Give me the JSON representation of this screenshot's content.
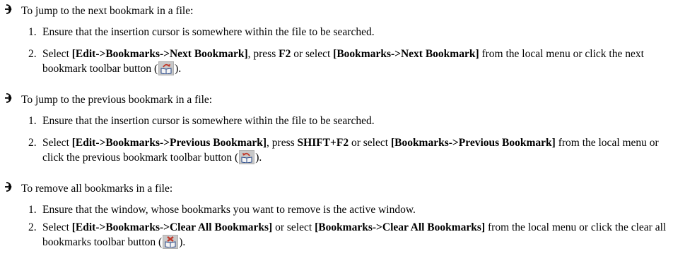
{
  "tasks": [
    {
      "title": "To jump to the next bookmark in a file:",
      "steps": [
        {
          "num": "1.",
          "text": "Ensure that the insertion cursor is somewhere within the file to be searched."
        },
        {
          "num": "2.",
          "select": "Select ",
          "menu1": "[Edit->Bookmarks->Next Bookmark]",
          "press": ", press ",
          "key": "F2",
          "or_select": " or select ",
          "menu2": "[Bookmarks->Next Bookmark]",
          "from": " from the local menu or click the next bookmark toolbar button (",
          "icon": "next-bookmark-icon",
          "close": ")."
        }
      ]
    },
    {
      "title": "To jump to the previous bookmark in a file:",
      "steps": [
        {
          "num": "1.",
          "text": "Ensure that the insertion cursor is somewhere within the file to be searched."
        },
        {
          "num": "2.",
          "select": "Select ",
          "menu1": "[Edit->Bookmarks->Previous Bookmark]",
          "press": ", press ",
          "key": "SHIFT+F2",
          "or_select": " or select ",
          "menu2": "[Bookmarks->Previous Bookmark]",
          "from": " from the local menu or click the previous bookmark toolbar button (",
          "icon": "previous-bookmark-icon",
          "close": ")."
        }
      ]
    },
    {
      "title": "To remove all bookmarks in a file:",
      "steps": [
        {
          "num": "1.",
          "text": "Ensure that the window, whose bookmarks you want to remove is the active window."
        },
        {
          "num": "2.",
          "select": "Select ",
          "menu1": "[Edit->Bookmarks->Clear All Bookmarks]",
          "or_select": " or select ",
          "menu2": "[Bookmarks->Clear All Bookmarks]",
          "from": " from the local menu or click the clear all bookmarks toolbar button (",
          "icon": "clear-all-bookmarks-icon",
          "close": ")."
        }
      ]
    }
  ],
  "colors": {
    "text": "#000000",
    "icon_button_bg": "#c8c8c8",
    "bookmark_red": "#c0392b",
    "bookmark_blue": "#2a4a8a"
  }
}
